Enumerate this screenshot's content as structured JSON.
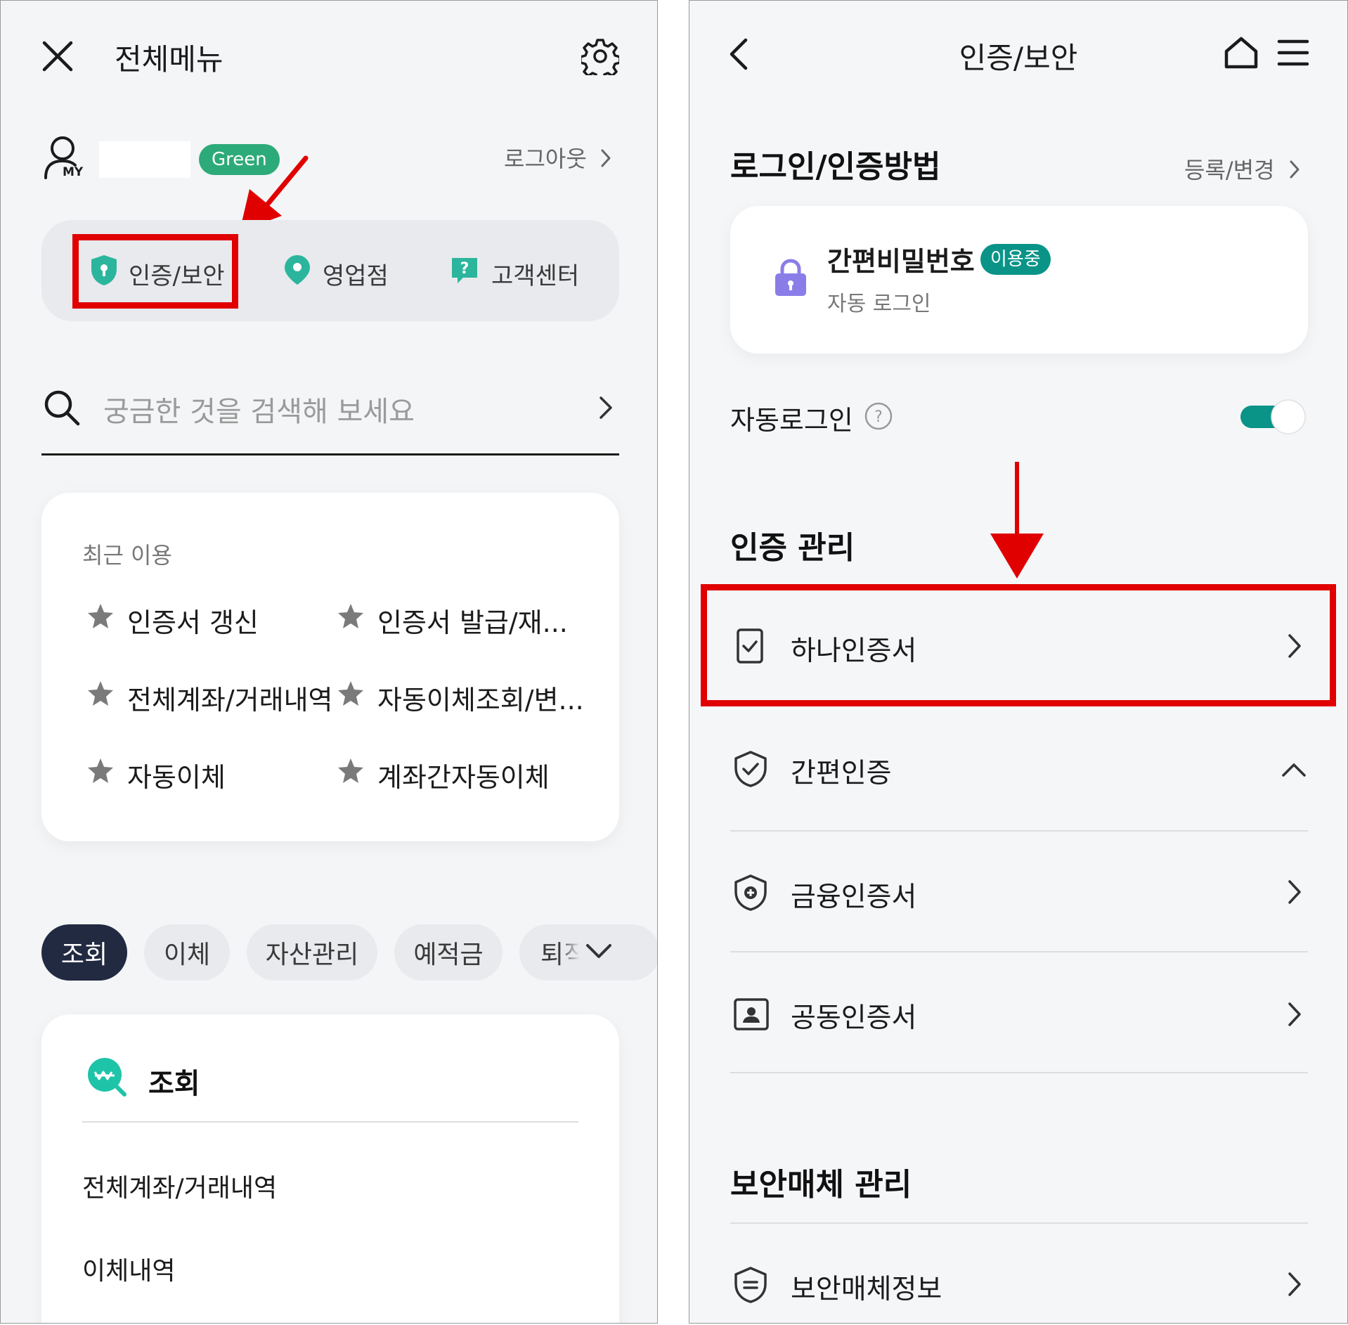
{
  "left": {
    "header": {
      "title": "전체메뉴"
    },
    "profile": {
      "badge": "Green",
      "my_label": "MY",
      "logout": "로그아웃"
    },
    "quick": [
      {
        "label": "인증/보안"
      },
      {
        "label": "영업점"
      },
      {
        "label": "고객센터"
      }
    ],
    "search": {
      "placeholder": "궁금한 것을 검색해 보세요"
    },
    "recent": {
      "title": "최근 이용",
      "items": [
        "인증서 갱신",
        "인증서 발급/재...",
        "전체계좌/거래내역",
        "자동이체조회/변...",
        "자동이체",
        "계좌간자동이체"
      ]
    },
    "tabs": [
      "조회",
      "이체",
      "자산관리",
      "예적금",
      "퇴직"
    ],
    "menu_card": {
      "title": "조회",
      "items": [
        "전체계좌/거래내역",
        "이체내역"
      ]
    }
  },
  "right": {
    "header": {
      "title": "인증/보안"
    },
    "login_method": {
      "title": "로그인/인증방법",
      "link": "등록/변경",
      "card": {
        "name": "간편비밀번호",
        "badge": "이용중",
        "sub": "자동 로그인"
      }
    },
    "auto_login": {
      "label": "자동로그인",
      "on": true
    },
    "cert_manage": {
      "title": "인증 관리",
      "items": [
        {
          "label": "하나인증서",
          "icon": "cert-check-icon"
        },
        {
          "label": "간편인증",
          "icon": "shield-check-icon"
        },
        {
          "label": "금융인증서",
          "icon": "shield-plus-icon"
        },
        {
          "label": "공동인증서",
          "icon": "id-card-icon"
        }
      ]
    },
    "security_media": {
      "title": "보안매체 관리",
      "items": [
        {
          "label": "보안매체정보",
          "icon": "shield-lines-icon"
        }
      ]
    }
  },
  "colors": {
    "accent_teal": "#0a9488",
    "badge_green": "#2daa7a",
    "highlight_red": "#e00000",
    "dark_pill": "#222a42"
  }
}
